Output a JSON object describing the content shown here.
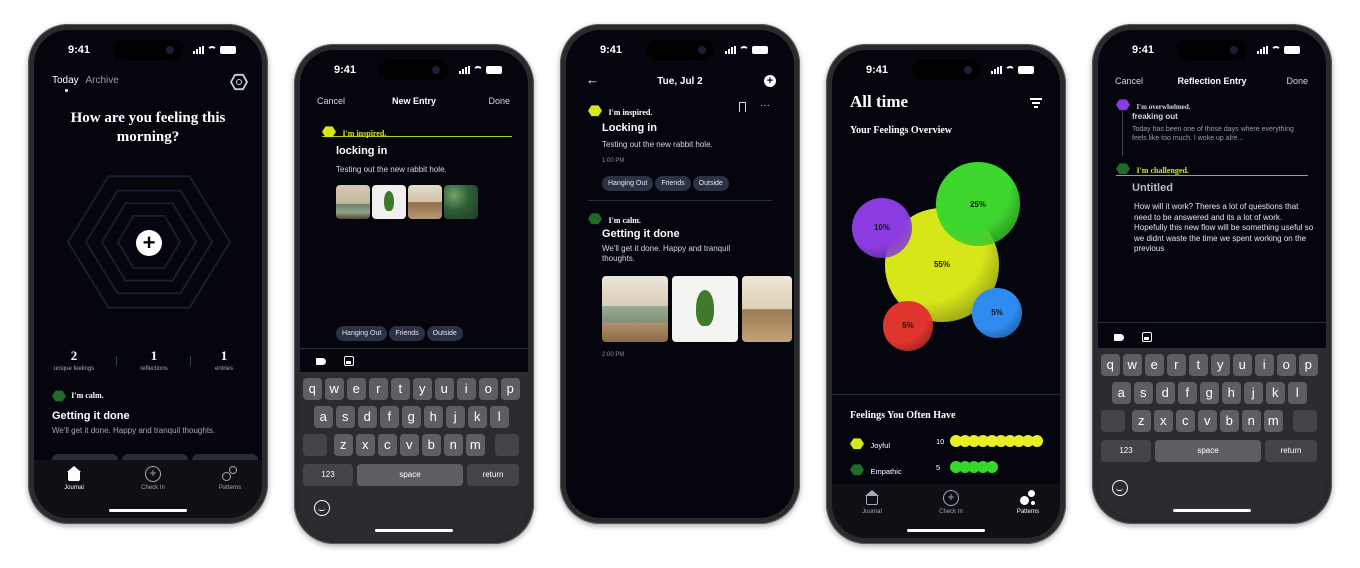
{
  "status_time": "9:41",
  "phone1": {
    "tabs": [
      "Today",
      "Archive"
    ],
    "question": "How are you feeling this morning?",
    "stats": [
      {
        "value": "2",
        "label": "unique feelings"
      },
      {
        "value": "1",
        "label": "reflections"
      },
      {
        "value": "1",
        "label": "entries"
      }
    ],
    "feeling": "I'm calm.",
    "entry_title": "Getting it done",
    "entry_body": "We'll get it done. Happy and tranquil thoughts.",
    "nav": [
      "Journal",
      "Check In",
      "Patterns"
    ]
  },
  "phone2": {
    "cancel": "Cancel",
    "title": "New Entry",
    "done": "Done",
    "feeling": "I'm inspired.",
    "entry_title": "locking in",
    "entry_body": "Testing out the new rabbit hole.",
    "tags": [
      "Hanging Out",
      "Friends",
      "Outside"
    ]
  },
  "phone3": {
    "date": "Tue, Jul 2",
    "entry1": {
      "feeling": "I'm inspired.",
      "title": "Locking in",
      "body": "Testing out the new rabbit hole.",
      "time": "1:00 PM",
      "tags": [
        "Hanging Out",
        "Friends",
        "Outside"
      ]
    },
    "entry2": {
      "feeling": "I'm calm.",
      "title": "Getting it done",
      "body": "We'll get it done. Happy and tranquil thoughts.",
      "time": "2:00 PM"
    }
  },
  "phone4": {
    "title": "All time",
    "overview_title": "Your Feelings Overview",
    "bubbles": [
      {
        "label": "55%",
        "value": 55,
        "color": "#d6e619"
      },
      {
        "label": "25%",
        "value": 25,
        "color": "#3ed72e"
      },
      {
        "label": "10%",
        "value": 10,
        "color": "#8a3ce0"
      },
      {
        "label": "5%",
        "value": 5,
        "color": "#2f8bf0"
      },
      {
        "label": "5%",
        "value": 5,
        "color": "#e0352d"
      }
    ],
    "often_title": "Feelings You Often Have",
    "often": [
      {
        "name": "Joyful",
        "count": "10",
        "color": "#e8ef22"
      },
      {
        "name": "Empathic",
        "count": "5",
        "color": "#36d92a"
      }
    ],
    "nav": [
      "Journal",
      "Check In",
      "Patterns"
    ]
  },
  "phone5": {
    "cancel": "Cancel",
    "title": "Reflection Entry",
    "done": "Done",
    "prev_feeling": "I'm overwhelmed.",
    "prev_title": "freaking out",
    "prev_body": "Today has been one of those days where everything feels like too much. I woke up alre...",
    "feeling": "I'm challenged.",
    "entry_title": "Untitled",
    "entry_body": "How will it work? Theres a lot of questions that need to be answered and its a lot of work. Hopefully this new flow will be something useful so we didnt waste the time we spent working on the previous"
  },
  "keyboard": {
    "row1": [
      "q",
      "w",
      "e",
      "r",
      "t",
      "y",
      "u",
      "i",
      "o",
      "p"
    ],
    "row2": [
      "a",
      "s",
      "d",
      "f",
      "g",
      "h",
      "j",
      "k",
      "l"
    ],
    "row3": [
      "z",
      "x",
      "c",
      "v",
      "b",
      "n",
      "m"
    ],
    "num": "123",
    "space": "space",
    "return": "return"
  },
  "colors": {
    "background": "#05060d",
    "accent_yellow": "#d6e619",
    "accent_green": "#3ed72e",
    "chip": "#2b3244"
  }
}
